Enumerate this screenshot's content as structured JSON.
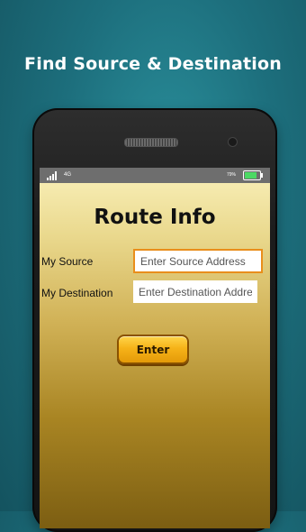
{
  "promo": {
    "headline": "Find Source & Destination"
  },
  "status_bar": {
    "network": "4G",
    "battery_percent": "79%",
    "battery_level": 0.79,
    "signal_icon": "signal-bars-icon",
    "battery_icon": "battery-icon"
  },
  "app": {
    "title": "Route Info",
    "source_label": "My Source",
    "source_placeholder": "Enter Source Address",
    "source_value": "",
    "destination_label": "My Destination",
    "destination_placeholder": "Enter Destination Address",
    "destination_value": "",
    "enter_label": "Enter"
  },
  "colors": {
    "background": "#1d6f7d",
    "accent": "#f6b319",
    "focus_border": "#e98e1b"
  }
}
